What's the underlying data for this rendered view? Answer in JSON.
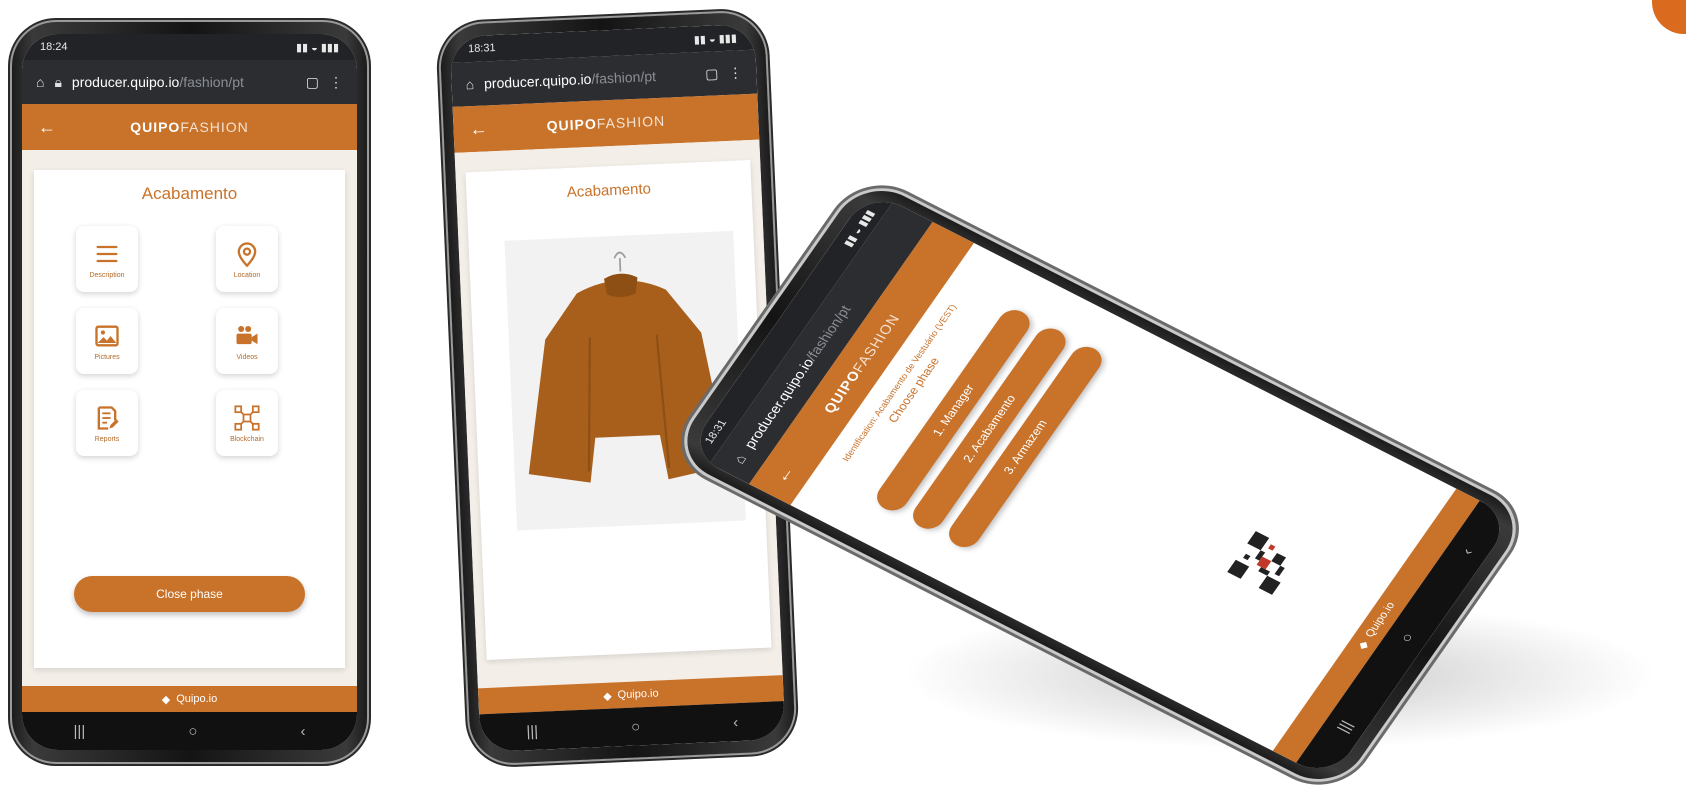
{
  "browser": {
    "status_time_1": "18:24",
    "status_time_2": "18:31",
    "url_host": "producer.quipo.io",
    "url_path": "/fashion/pt"
  },
  "app": {
    "brand_bold": "QUIPO",
    "brand_light": "FASHION",
    "back_icon": "arrow-left-icon",
    "footer_text": "Quipo.io"
  },
  "phone1": {
    "title": "Acabamento",
    "tiles": [
      {
        "label": "Description",
        "icon": "menu-lines-icon"
      },
      {
        "label": "Location",
        "icon": "map-pin-icon"
      },
      {
        "label": "Pictures",
        "icon": "image-icon"
      },
      {
        "label": "Videos",
        "icon": "video-camera-icon"
      },
      {
        "label": "Reports",
        "icon": "report-edit-icon"
      },
      {
        "label": "Blockchain",
        "icon": "network-nodes-icon"
      }
    ],
    "button": "Close phase"
  },
  "phone2": {
    "title": "Acabamento"
  },
  "phone3": {
    "header_line": "Identification: Acabamento de Vestuário (VEST)",
    "sub_line": "Choose phase",
    "phases": [
      "1. Manager",
      "2. Acabamento",
      "3. Armazem"
    ]
  },
  "colors": {
    "accent": "#c8722a",
    "dark": "#212326"
  }
}
